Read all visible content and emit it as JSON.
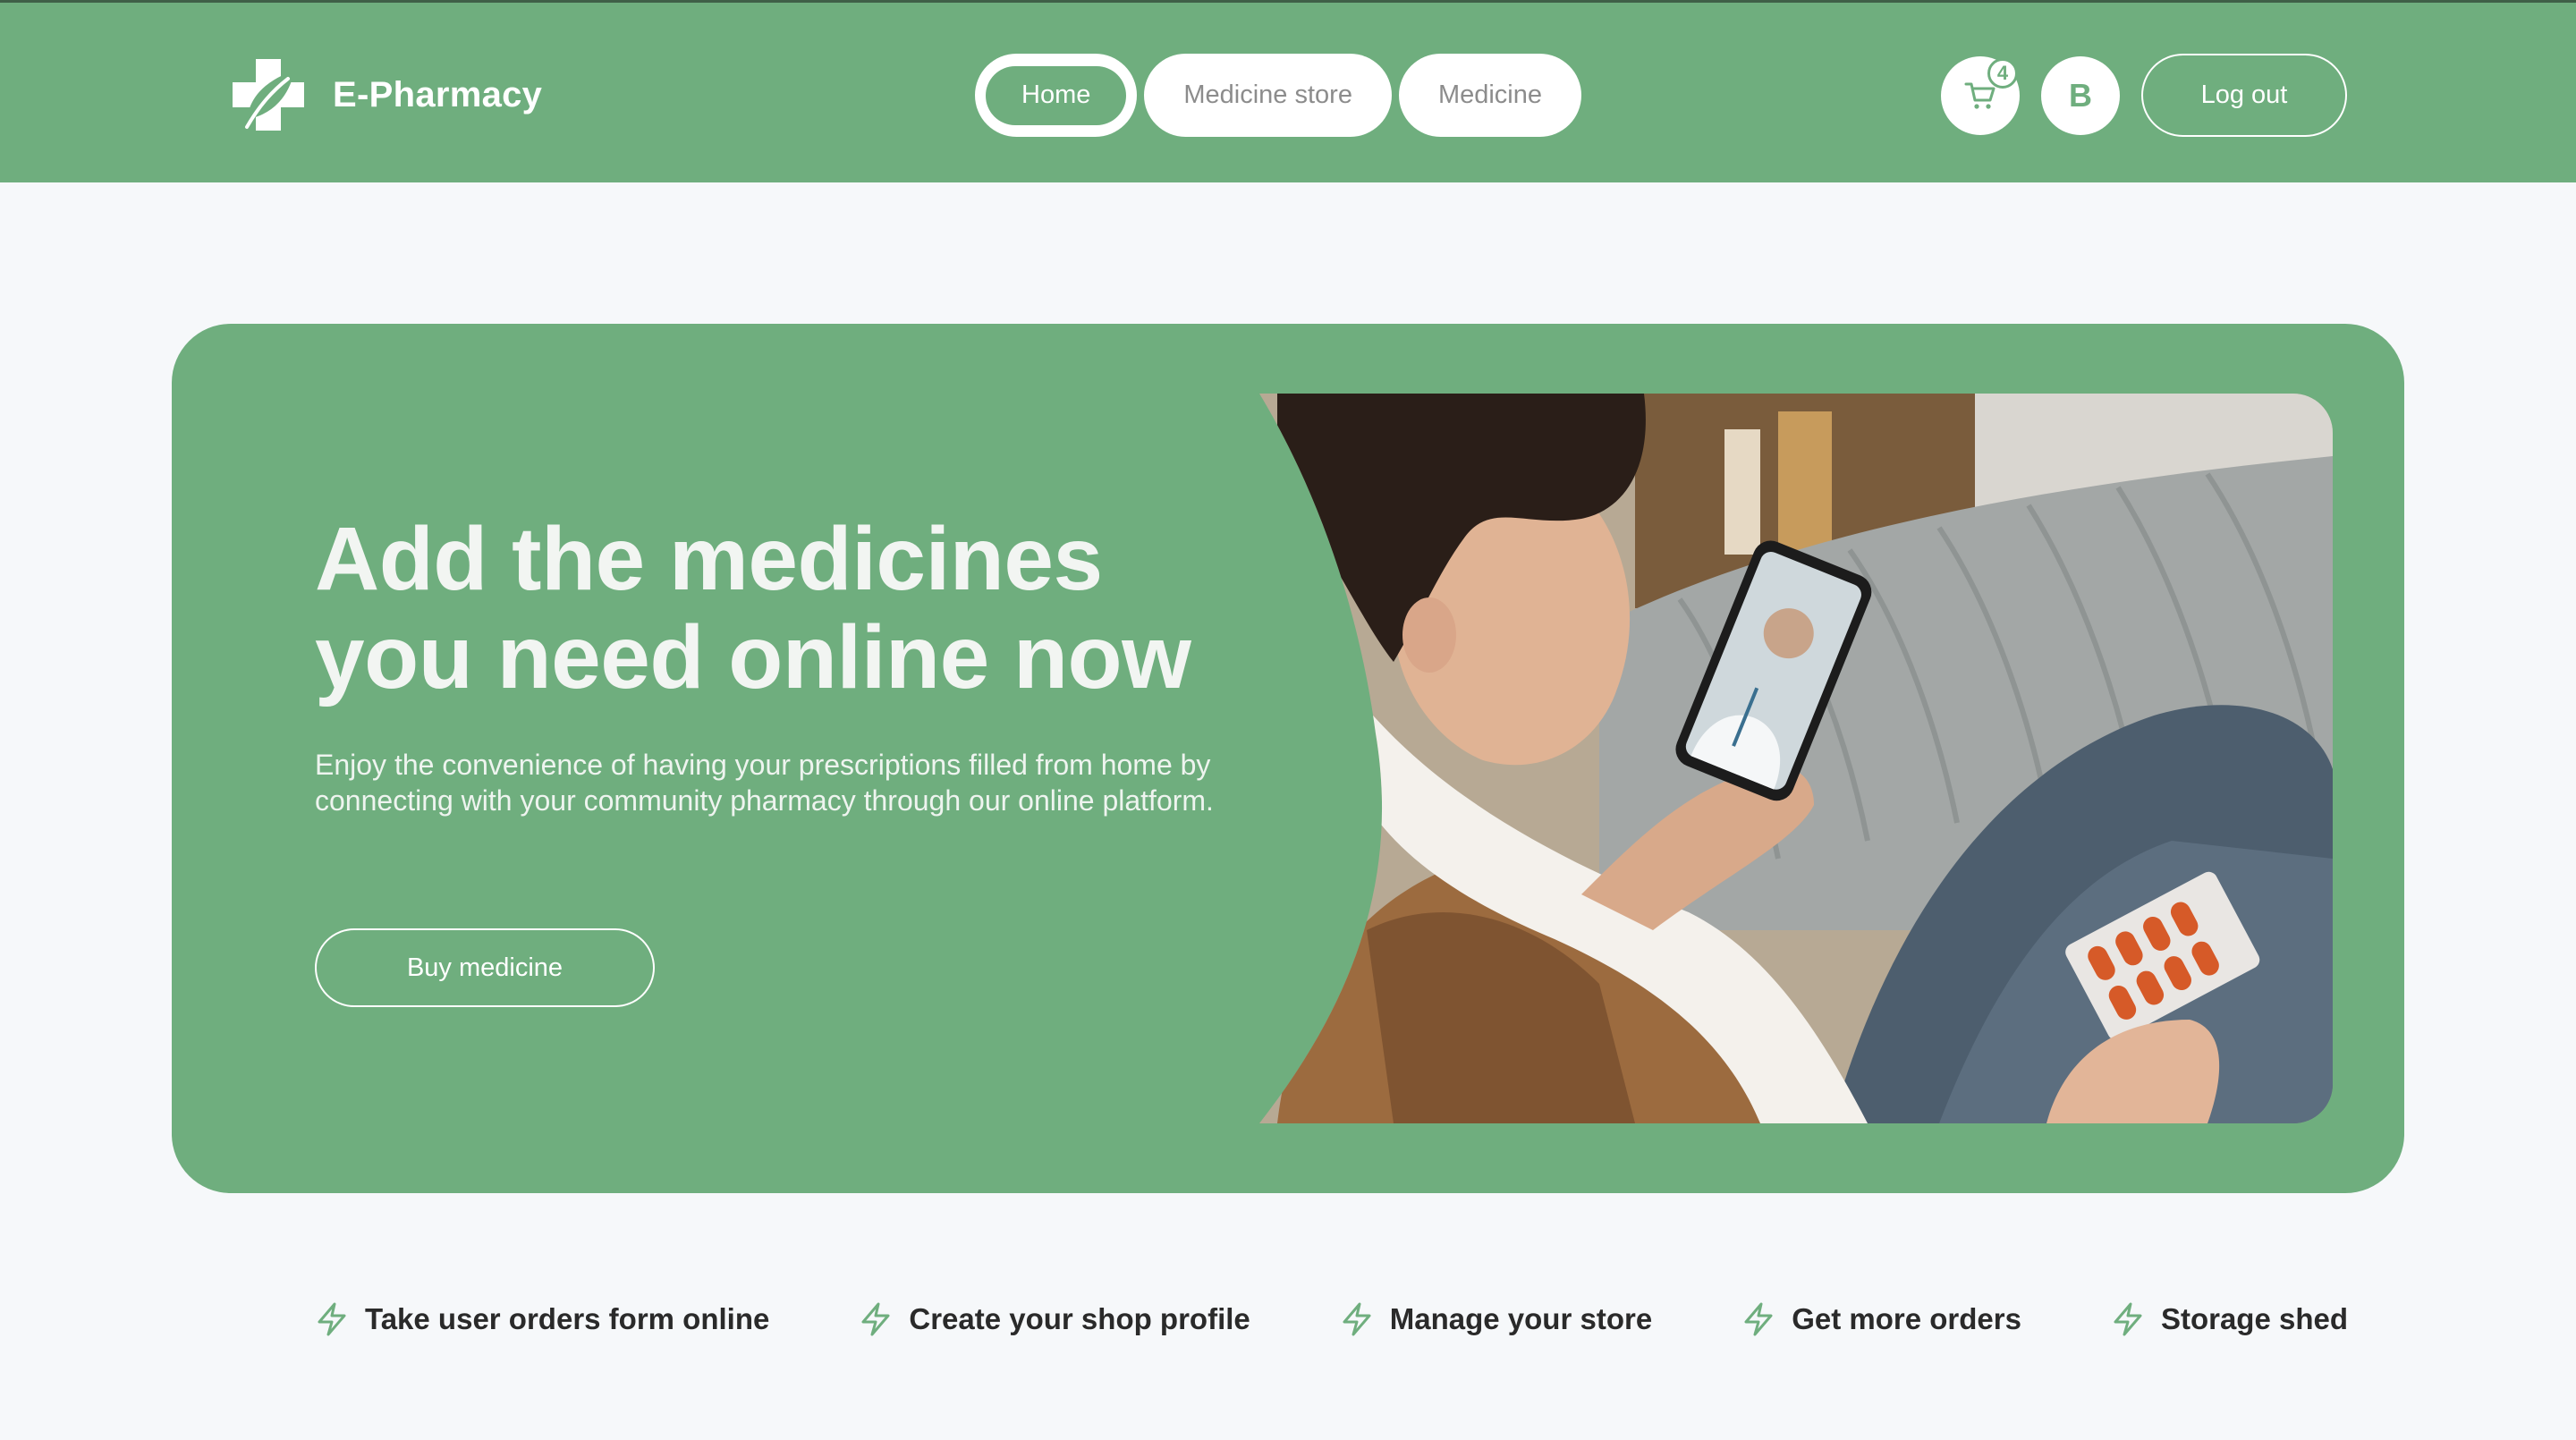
{
  "app": {
    "name": "E-Pharmacy",
    "brand_color": "#6fae7e",
    "logo_icon": "leaf-cross-icon"
  },
  "nav": {
    "items": [
      {
        "label": "Home",
        "active": true
      },
      {
        "label": "Medicine store",
        "active": false
      },
      {
        "label": "Medicine",
        "active": false
      }
    ]
  },
  "header": {
    "cart_icon": "cart-icon",
    "cart_count": "4",
    "avatar_initial": "B",
    "logout_label": "Log out"
  },
  "hero": {
    "title_line1": "Add the medicines",
    "title_line2": "you need online now",
    "description": "Enjoy the convenience of having your prescriptions filled from home by connecting with your community pharmacy through our online platform.",
    "button_label": "Buy medicine",
    "image_subject": "woman-on-couch-video-call-with-doctor-holding-pills"
  },
  "features": [
    {
      "icon": "lightning-icon",
      "label": "Take user orders form online"
    },
    {
      "icon": "lightning-icon",
      "label": "Create your shop profile"
    },
    {
      "icon": "lightning-icon",
      "label": "Manage your store"
    },
    {
      "icon": "lightning-icon",
      "label": "Get more orders"
    },
    {
      "icon": "lightning-icon",
      "label": "Storage shed"
    }
  ]
}
